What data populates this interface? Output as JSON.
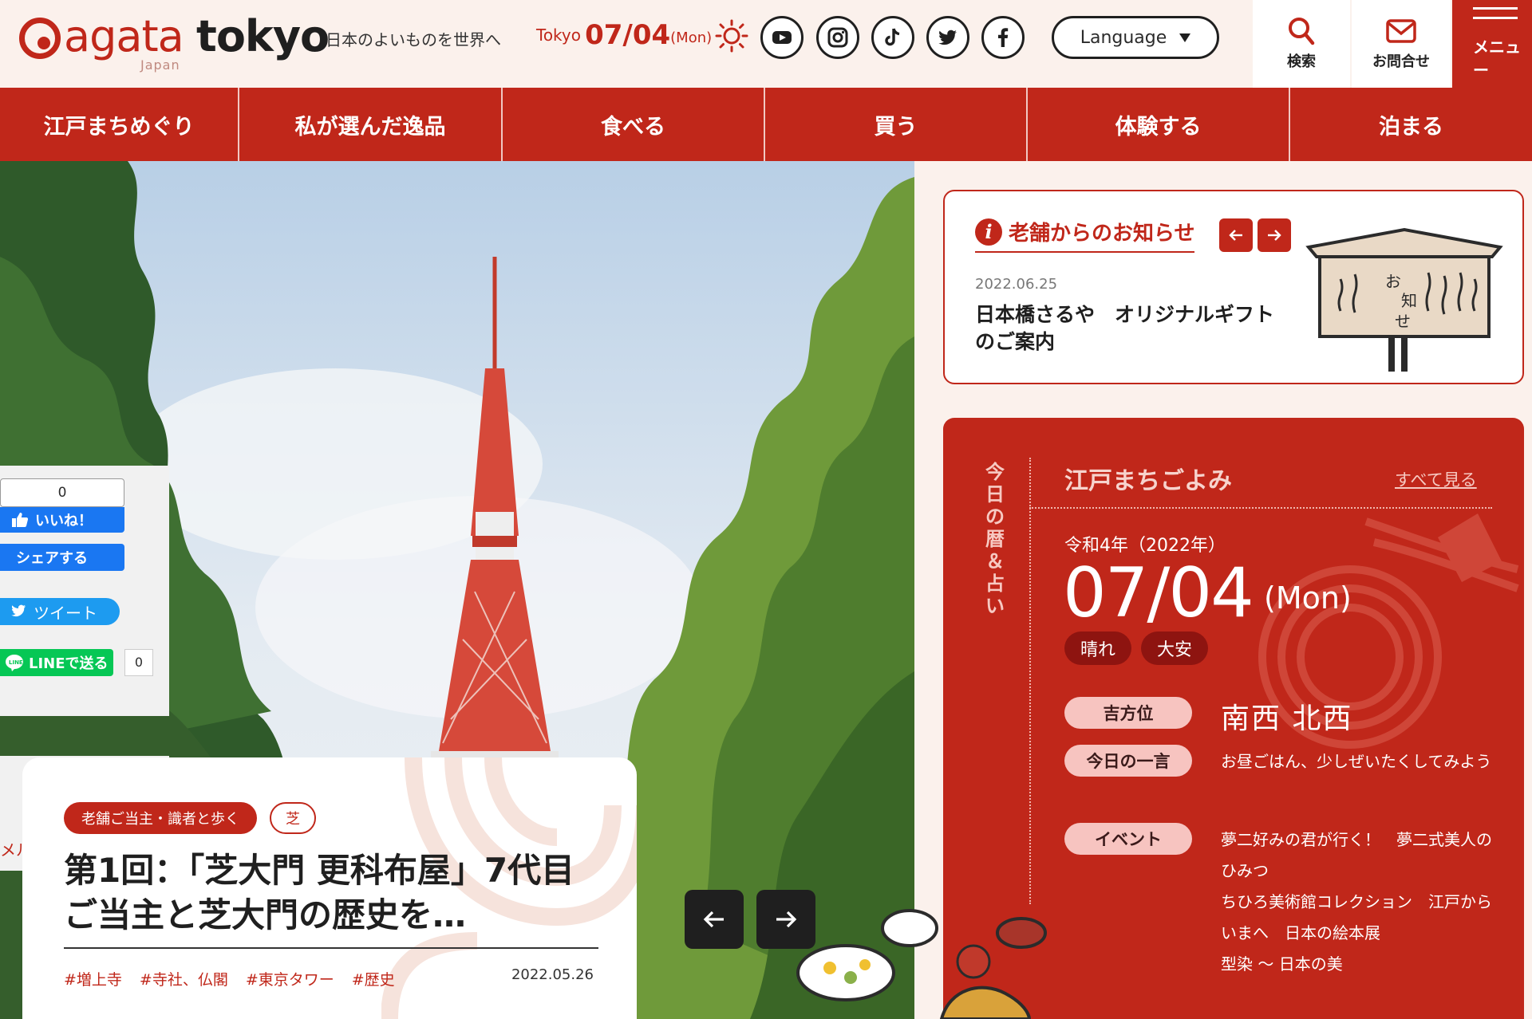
{
  "header": {
    "logo": {
      "agata": "agata",
      "tokyo": "tokyo",
      "japan": "Japan"
    },
    "tagline": "日本のよいものを世界へ",
    "weather": {
      "city": "Tokyo",
      "date": "07/04",
      "dow": "(Mon)",
      "icon": "sun-icon"
    },
    "social": [
      "youtube-icon",
      "instagram-icon",
      "tiktok-icon",
      "twitter-icon",
      "facebook-icon"
    ],
    "language_label": "Language",
    "search_label": "検索",
    "contact_label": "お問合せ",
    "menu_label": "メニュー"
  },
  "nav": [
    "江戸まちめぐり",
    "私が選んだ逸品",
    "食べる",
    "買う",
    "体験する",
    "泊まる"
  ],
  "share": {
    "fb_count": "0",
    "fb_like": "いいね！",
    "fb_share": "シェアする",
    "tweet": "ツイート",
    "line": "LINEで送る",
    "line_count": "0",
    "newsletter": "メルマガを登録する"
  },
  "feature": {
    "tags": [
      "老舗ご当主・識者と歩く",
      "芝"
    ],
    "title": "第1回：「芝大門 更科布屋」7代目ご当主と芝大門の歴史を…",
    "hashtags": [
      "#増上寺",
      "#寺社、仏閣",
      "#東京タワー",
      "#歴史"
    ],
    "date": "2022.05.26"
  },
  "notice": {
    "title": "老舗からのお知らせ",
    "date": "2022.06.25",
    "text": "日本橋さるや　オリジナルギフトのご案内"
  },
  "calendar": {
    "vertical_label": "今日の暦＆占い",
    "title": "江戸まちごよみ",
    "see_all": "すべて見る",
    "era": "令和4年（2022年）",
    "date": "07/04",
    "dow": "(Mon)",
    "weather": "晴れ",
    "rokuyo": "大安",
    "lucky_label": "吉方位",
    "lucky_value": "南西  北西",
    "word_label": "今日の一言",
    "word_value": "お昼ごはん、少しぜいたくしてみよう",
    "event_label": "イベント",
    "events": [
      "夢二好みの君が行く！　夢二式美人のひみつ",
      "ちひろ美術館コレクション　江戸からいまへ　日本の絵本展",
      "型染 〜 日本の美"
    ]
  },
  "colors": {
    "brand_red": "#c0271a",
    "dark_red": "#8e1410",
    "pink": "#f7c4c0",
    "background": "#fbf1ec"
  }
}
